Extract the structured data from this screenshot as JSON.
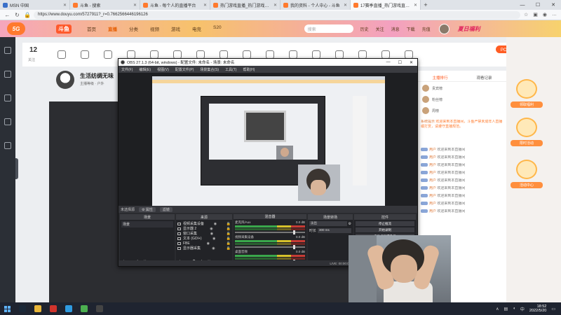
{
  "browser": {
    "tabs": [
      {
        "label": "MSN 中国",
        "color": "#3a70c9",
        "active": false
      },
      {
        "label": "斗鱼 - 搜索",
        "color": "#ff7a2e",
        "active": false
      },
      {
        "label": "斗鱼 - 每个人的直播平台",
        "color": "#ff7a2e",
        "active": false
      },
      {
        "label": "热门游戏直播_热门游戏视频_热",
        "color": "#ff7a2e",
        "active": false
      },
      {
        "label": "我的资料 - 个人中心 - 斗鱼",
        "color": "#ff7a2e",
        "active": false
      },
      {
        "label": "17赛季直播_热门游戏直播_斗鱼",
        "color": "#ff7a2e",
        "active": true
      }
    ],
    "new_tab": "+",
    "url": "https://www.douyu.com/5727911?_r=0.7662566446196126",
    "window_buttons": [
      "—",
      "☐",
      "✕"
    ]
  },
  "site": {
    "logo": "5G",
    "brand": "斗鱼",
    "nav": [
      {
        "label": "首页",
        "active": false
      },
      {
        "label": "直播",
        "active": true
      },
      {
        "label": "分类",
        "active": false
      },
      {
        "label": "视频",
        "active": false
      },
      {
        "label": "游戏",
        "active": false
      },
      {
        "label": "电竞",
        "active": false
      },
      {
        "label": "S20",
        "active": false
      }
    ],
    "search_placeholder": "搜索",
    "header_icons": [
      "历史",
      "关注",
      "消息",
      "下载",
      "充值"
    ],
    "promo": "夏日福利"
  },
  "room": {
    "follower_count": "12",
    "follower_label": "关注",
    "pc_button": "PC客户端",
    "streamer_title": "生活纺绸无味",
    "streamer_tags": "主播等级 · 户外",
    "right_tabs": [
      {
        "label": "主播排行",
        "active": true
      },
      {
        "label": "观看记录",
        "active": false
      }
    ],
    "fans": [
      "贵宾榜",
      "粉丝榜",
      "周榜"
    ],
    "chat": [
      {
        "user": "系统提示",
        "text": "欢迎来到本直播间，斗鱼严禁未成年人直播或打赏，请遵守直播规范。",
        "system": true
      },
      {
        "user": "用户",
        "text": "欢迎来到本直播间"
      },
      {
        "user": "用户",
        "text": "欢迎来到本直播间"
      },
      {
        "user": "用户",
        "text": "欢迎来到本直播间"
      },
      {
        "user": "用户",
        "text": "欢迎来到本直播间"
      },
      {
        "user": "用户",
        "text": "欢迎来到本直播间"
      },
      {
        "user": "用户",
        "text": "欢迎来到本直播间"
      },
      {
        "user": "用户",
        "text": "欢迎来到本直播间"
      },
      {
        "user": "用户",
        "text": "欢迎来到本直播间"
      },
      {
        "user": "用户",
        "text": "欢迎来到本直播间"
      }
    ],
    "promo_labels": [
      "领取福利",
      "限时活动",
      "活动中心"
    ]
  },
  "obs": {
    "title": "OBS 27.1.3 (64-bit, windows) - 配置文件: 未命名 - 场景: 未命名",
    "menu": [
      "文件(F)",
      "编辑(E)",
      "视图(V)",
      "配置文件(P)",
      "场景集合(S)",
      "工具(T)",
      "帮助(H)"
    ],
    "window_buttons": [
      "—",
      "☐",
      "✕"
    ],
    "scene_bar": {
      "label": "未选择源",
      "props": "⚙ 属性",
      "filters": "滤镜"
    },
    "docks": {
      "scenes": {
        "title": "场景",
        "items": [
          "场景"
        ]
      },
      "sources": {
        "title": "来源",
        "items": [
          "视频采集设备",
          "显示器 2",
          "窗口采集",
          "文本 (GDI+)",
          "FBE",
          "显示器采集"
        ]
      },
      "mixer": {
        "title": "混音器",
        "channels": [
          {
            "name": "麦克风/Aux",
            "db": "0.0 dB"
          },
          {
            "name": "视频采集设备",
            "db": "0.0 dB"
          },
          {
            "name": "桌面音频",
            "db": "0.0 dB"
          }
        ]
      },
      "transitions": {
        "title": "场景转场",
        "type": "淡出",
        "duration_label": "时长",
        "duration": "300 ms"
      },
      "controls": {
        "title": "控件",
        "buttons": [
          "停止推流",
          "开始录制",
          "启动虚拟摄像机",
          "工作室模式",
          "设置",
          "退出"
        ]
      }
    },
    "status": [
      "LIVE: 00:00:00",
      "REC: 00:00:00",
      "CPU: 3.2%, 30.00 fps"
    ]
  },
  "taskbar": {
    "time": "18:52",
    "date": "2022/5/20",
    "apps": [
      {
        "name": "steam",
        "color": "#1b2838"
      },
      {
        "name": "folder",
        "color": "#e8b63a"
      },
      {
        "name": "netease",
        "color": "#d0342c"
      },
      {
        "name": "edge",
        "color": "#2f9be0"
      },
      {
        "name": "chrome",
        "color": "#4caf50"
      },
      {
        "name": "obs",
        "color": "#444"
      }
    ]
  }
}
